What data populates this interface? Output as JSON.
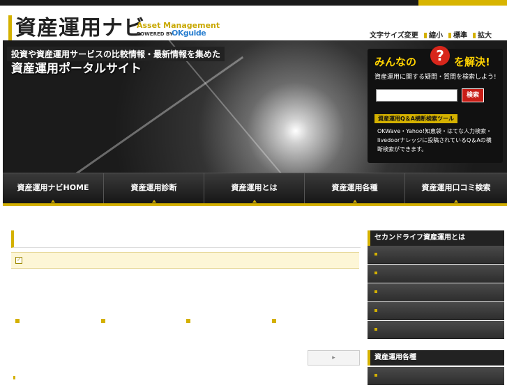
{
  "top_badge": "",
  "header": {
    "logo_jp": "資産運用ナビ",
    "logo_en": "Asset Management",
    "powered_by": "POWERED BY",
    "brand": "OKguide",
    "font_size_label": "文字サイズ変更",
    "font_small": "縮小",
    "font_standard": "標準",
    "font_large": "拡大"
  },
  "hero": {
    "tagline": "投資や資産運用サービスの比較情報・最新情報を集めた",
    "title": "資産運用ポータルサイト"
  },
  "qa_panel": {
    "head_a": "みんなの",
    "qmark": "?",
    "head_b": "を解決!",
    "subtitle": "資産運用に関する疑問・質問を検索しよう!",
    "search_value": "",
    "search_button": "検索",
    "tool_label": "資産運用Q＆A横断検索ツール",
    "description": "OKWave・Yahoo!知恵袋・はてな人力検索・livedoorナレッジに投稿されているQ＆Aの横断検索ができます。"
  },
  "nav": {
    "items": [
      {
        "label": "資産運用ナビHOME"
      },
      {
        "label": "資産運用診断"
      },
      {
        "label": "資産運用とは"
      },
      {
        "label": "資産運用各種"
      },
      {
        "label": "資産運用口コミ検索"
      }
    ]
  },
  "main": {
    "title": "",
    "subbar": "",
    "paragraphs": [
      "",
      "",
      "",
      ""
    ],
    "links": [
      "",
      "",
      "",
      ""
    ],
    "footer_text": "",
    "more_button": ""
  },
  "sidebar": {
    "section1_head": "セカンドライフ資産運用とは",
    "section1_items": [
      "",
      "",
      "",
      "",
      ""
    ],
    "section2_head": "資産運用各種",
    "section2_items": [
      ""
    ]
  }
}
